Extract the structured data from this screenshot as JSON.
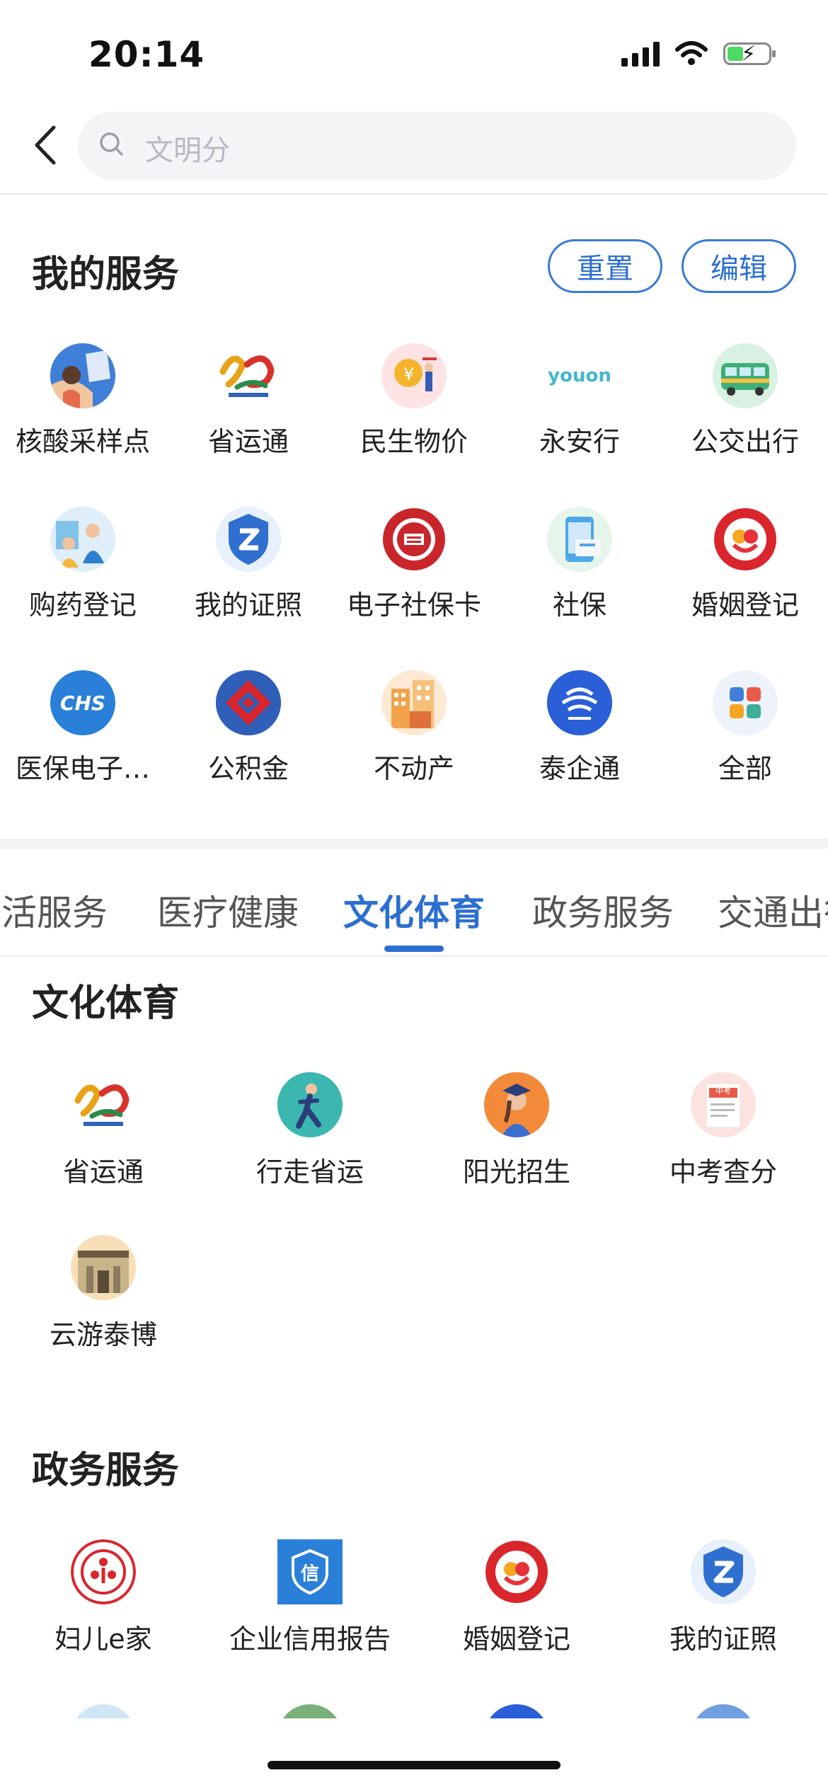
{
  "status_bar": {
    "time": "20:14"
  },
  "search": {
    "placeholder": "文明分"
  },
  "my_services": {
    "title": "我的服务",
    "reset_label": "重置",
    "edit_label": "编辑",
    "items": [
      {
        "label": "核酸采样点",
        "icon": "nucleic-test-icon"
      },
      {
        "label": "省运通",
        "icon": "sports-games-logo-icon"
      },
      {
        "label": "民生物价",
        "icon": "price-icon"
      },
      {
        "label": "永安行",
        "icon": "youon-logo-icon"
      },
      {
        "label": "公交出行",
        "icon": "bus-icon"
      },
      {
        "label": "购药登记",
        "icon": "medicine-registration-icon"
      },
      {
        "label": "我的证照",
        "icon": "license-shield-icon"
      },
      {
        "label": "电子社保卡",
        "icon": "social-security-card-icon"
      },
      {
        "label": "社保",
        "icon": "social-insurance-icon"
      },
      {
        "label": "婚姻登记",
        "icon": "marriage-registration-icon"
      },
      {
        "label": "医保电子…",
        "icon": "chs-medical-insurance-icon"
      },
      {
        "label": "公积金",
        "icon": "housing-fund-icon"
      },
      {
        "label": "不动产",
        "icon": "real-estate-icon"
      },
      {
        "label": "泰企通",
        "icon": "taiqitong-icon"
      },
      {
        "label": "全部",
        "icon": "all-apps-icon"
      }
    ],
    "youon_text": "youon",
    "chs_text": "CHS"
  },
  "category_tabs": [
    {
      "label": "生活服务"
    },
    {
      "label": "医疗健康"
    },
    {
      "label": "文化体育",
      "active": true
    },
    {
      "label": "政务服务"
    },
    {
      "label": "交通出行"
    }
  ],
  "culture_section": {
    "title": "文化体育",
    "items": [
      {
        "label": "省运通",
        "icon": "sports-games-logo-icon"
      },
      {
        "label": "行走省运",
        "icon": "walking-runner-icon"
      },
      {
        "label": "阳光招生",
        "icon": "graduate-icon"
      },
      {
        "label": "中考查分",
        "icon": "exam-score-icon"
      },
      {
        "label": "云游泰博",
        "icon": "museum-icon"
      }
    ],
    "exam_text": "中考"
  },
  "gov_section": {
    "title": "政务服务",
    "items": [
      {
        "label": "妇儿e家",
        "icon": "women-children-icon"
      },
      {
        "label": "企业信用报告",
        "icon": "credit-report-icon"
      },
      {
        "label": "婚姻登记",
        "icon": "marriage-registration-icon"
      },
      {
        "label": "我的证照",
        "icon": "license-shield-icon"
      }
    ],
    "credit_text": "信"
  },
  "colors": {
    "accent": "#2d6fd0",
    "background": "#ffffff",
    "search_bg": "#f3f4f6"
  }
}
